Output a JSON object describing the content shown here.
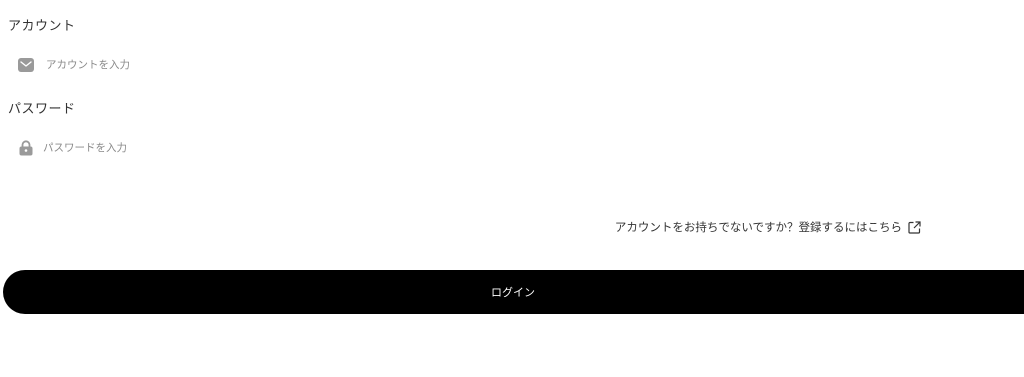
{
  "account": {
    "label": "アカウント",
    "placeholder": "アカウントを入力",
    "value": "",
    "icon": "mail-icon"
  },
  "password": {
    "label": "パスワード",
    "placeholder": "パスワードを入力",
    "value": "",
    "icon": "lock-icon"
  },
  "register": {
    "text": "アカウントをお持ちでないですか？登録するにはこちら",
    "icon": "external-link-icon"
  },
  "login": {
    "label": "ログイン"
  },
  "colors": {
    "button_bg": "#000000",
    "button_text": "#ffffff",
    "icon_gray": "#9a9a9a"
  }
}
